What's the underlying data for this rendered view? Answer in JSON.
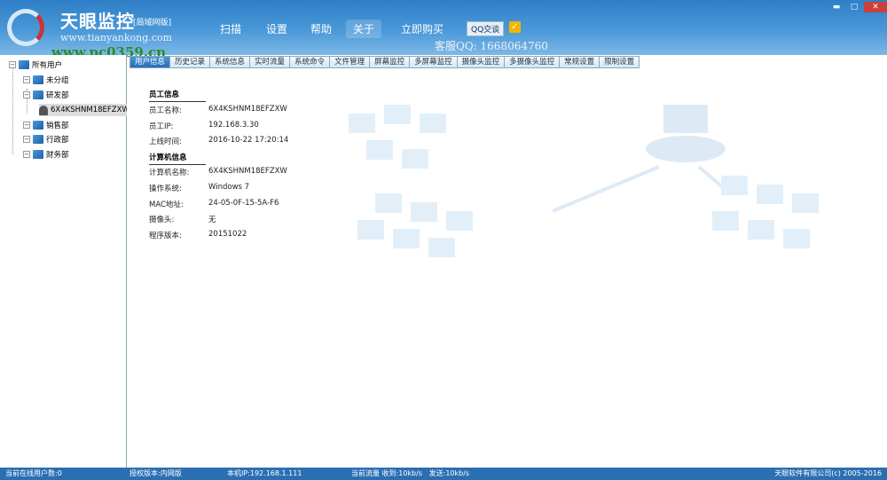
{
  "header": {
    "title": "天眼监控",
    "edition": "[局域网版]",
    "url": "www.tianyankong.com",
    "watermark": "www.pc0359.cn",
    "menu": [
      "扫描",
      "设置",
      "帮助",
      "关于",
      "立即购买"
    ],
    "qq_button": "QQ交谈",
    "service_qq": "客服QQ: 1668064760",
    "window_controls": {
      "minimize": "▬",
      "maximize": "□",
      "close": "✕"
    }
  },
  "tree": {
    "root": "所有用户",
    "groups": [
      "未分组",
      "研发部",
      "销售部",
      "行政部",
      "财务部"
    ],
    "selected_user": "6X4KSHNM18EFZXW"
  },
  "tabs": [
    "用户信息",
    "历史记录",
    "系统信息",
    "实时流量",
    "系统命令",
    "文件管理",
    "屏幕监控",
    "多屏幕监控",
    "摄像头监控",
    "多摄像头监控",
    "常规设置",
    "限制设置"
  ],
  "employee": {
    "heading": "员工信息",
    "rows": [
      {
        "label": "员工名称:",
        "value": "6X4KSHNM18EFZXW"
      },
      {
        "label": "员工IP:",
        "value": "192.168.3.30"
      },
      {
        "label": "上线时间:",
        "value": "2016-10-22 17:20:14"
      }
    ]
  },
  "computer": {
    "heading": "计算机信息",
    "rows": [
      {
        "label": "计算机名称:",
        "value": "6X4KSHNM18EFZXW"
      },
      {
        "label": "操作系统:",
        "value": "Windows 7"
      },
      {
        "label": "MAC地址:",
        "value": "24-05-0F-15-5A-F6"
      },
      {
        "label": "摄像头:",
        "value": "无"
      },
      {
        "label": "程序版本:",
        "value": "20151022"
      }
    ]
  },
  "status": {
    "online": "当前在线用户数:0",
    "license": "授权版本:内网版",
    "local_ip": "本机IP:192.168.1.111",
    "traffic": "当前流量 收到:10kb/s   发送:10kb/s",
    "copyright": "天眼软件有限公司(c) 2005-2016"
  }
}
